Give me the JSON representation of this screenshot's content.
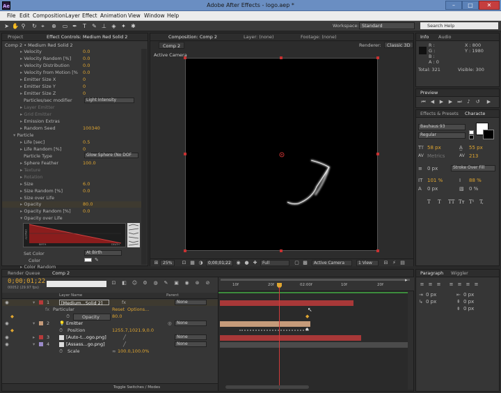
{
  "window": {
    "title": "Adobe After Effects - logo.aep *",
    "app_icon": "Ae"
  },
  "menu": [
    "File",
    "Edit",
    "Composition",
    "Layer",
    "Effect",
    "Animation",
    "View",
    "Window",
    "Help"
  ],
  "toolbar": {
    "workspace_label": "Workspace:",
    "workspace_value": "Standard",
    "search_placeholder": "Search Help"
  },
  "effect_controls": {
    "tabs": [
      "Project",
      "Effect Controls: Medium Red Solid 2"
    ],
    "header": "Comp 2 • Medium Red Solid 2",
    "rows": [
      {
        "label": "Velocity",
        "value": "0.0"
      },
      {
        "label": "Velocity Random [%]",
        "value": "0.0"
      },
      {
        "label": "Velocity Distribution",
        "value": "0.0"
      },
      {
        "label": "Velocity from Motion [%",
        "value": "0.0"
      },
      {
        "label": "Emitter Size X",
        "value": "0"
      },
      {
        "label": "Emitter Size Y",
        "value": "0"
      },
      {
        "label": "Emitter Size Z",
        "value": "0"
      },
      {
        "label": "Particles/sec modifier",
        "value": "Light Intensity"
      },
      {
        "label": "Layer Emitter",
        "value": ""
      },
      {
        "label": "Grid Emitter",
        "value": ""
      },
      {
        "label": "Emission Extras",
        "value": ""
      },
      {
        "label": "Random Seed",
        "value": "100340"
      },
      {
        "label": "Particle",
        "value": ""
      },
      {
        "label": "Life [sec]",
        "value": "0.5"
      },
      {
        "label": "Life Random [%]",
        "value": "0"
      },
      {
        "label": "Particle Type",
        "value": "Glow Sphere (No DOF"
      },
      {
        "label": "Sphere Feather",
        "value": "100.0"
      },
      {
        "label": "Texture",
        "value": ""
      },
      {
        "label": "Rotation",
        "value": ""
      },
      {
        "label": "Size",
        "value": "6.0"
      },
      {
        "label": "Size Random [%]",
        "value": "0.0"
      },
      {
        "label": "Size over Life",
        "value": ""
      },
      {
        "label": "Opacity",
        "value": "80.0"
      },
      {
        "label": "Opacity Random [%]",
        "value": "0.0"
      },
      {
        "label": "Opacity over Life",
        "value": ""
      }
    ],
    "graph_labels": {
      "left": "OPACITY",
      "bl": "BIRTH",
      "br": "DEATH"
    },
    "set_color_label": "Set Color",
    "set_color_value": "At Birth",
    "color_label": "Color",
    "color_random_label": "Color Random"
  },
  "composition": {
    "tabs": [
      "Composition: Comp 2",
      "Layer: (none)",
      "Footage: (none)"
    ],
    "comp_tab": "Comp 2",
    "renderer_label": "Renderer:",
    "renderer_value": "Classic 3D",
    "camera_label": "Active Camera",
    "zoom": "25%",
    "timecode": "0;00;01;22",
    "quality": "Full",
    "camera": "Active Camera",
    "views": "1 View"
  },
  "info": {
    "tabs": [
      "Info",
      "Audio"
    ],
    "r": "R :",
    "g": "G :",
    "b": "B :",
    "a": "A : 0",
    "x": "X : 800",
    "y": "Y : 1980",
    "total": "Total: 321",
    "visible": "Visible: 300"
  },
  "preview": {
    "tab": "Preview"
  },
  "character": {
    "tabs": [
      "Effects & Presets",
      "Characte"
    ],
    "font": "Bauhaus 93",
    "style": "Regular",
    "size": "58 px",
    "leading": "55 px",
    "kerning": "Metrics",
    "tracking": "213",
    "stroke": "0 px",
    "stroke_type": "Stroke Over Fill",
    "vscale": "101 %",
    "hscale": "88 %",
    "baseline": "0 px",
    "tsume": "0 %",
    "styles": [
      "T",
      "T",
      "TT",
      "Tт",
      "T¹",
      "T,"
    ]
  },
  "paragraph": {
    "tabs": [
      "Paragraph",
      "Wiggler"
    ],
    "v1": "0 px",
    "v2": "0 px",
    "v3": "0 px",
    "v4": "0 px",
    "v5": "0 px"
  },
  "timeline": {
    "tabs": [
      "Render Queue",
      "Comp 2"
    ],
    "timecode": "0;00;01;22",
    "fps": "00052 (29.97 fps)",
    "col_layer": "Layer Name",
    "col_parent": "Parent",
    "ruler": [
      "10f",
      "20f",
      "02:00f",
      "10f",
      "20f"
    ],
    "toggle_label": "Toggle Switches / Modes",
    "layers": [
      {
        "num": "1",
        "name": "[Medium...Solid 2]",
        "parent": "None"
      },
      {
        "sub": "Particular",
        "reset": "Reset",
        "options": "Options..."
      },
      {
        "sub2": "Opacity",
        "value": "80.0"
      },
      {
        "num": "2",
        "name": "Emitter",
        "parent": "None"
      },
      {
        "sub": "Position",
        "value": "1255.7,1021.9,0.0"
      },
      {
        "num": "3",
        "name": "[Auto-t...ogo.png]",
        "parent": "None"
      },
      {
        "num": "4",
        "name": "[Assass...go.png]",
        "parent": "None"
      },
      {
        "sub": "Scale",
        "value": "100.0,100.0%"
      }
    ]
  },
  "colors": {
    "accent": "#e0a630",
    "layer_red": "#b63a3a",
    "layer_tan": "#c59b7a",
    "playhead": "#d23a3a"
  }
}
